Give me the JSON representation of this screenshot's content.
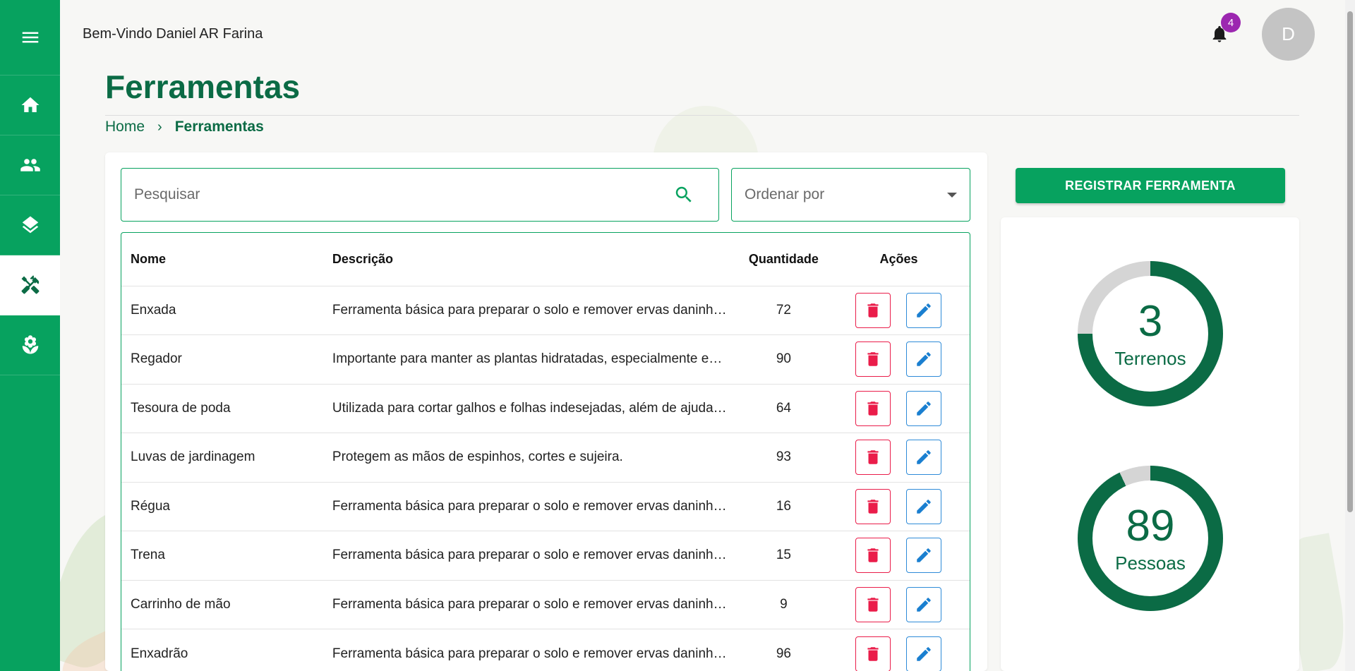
{
  "header": {
    "welcome_text": "Bem-Vindo Daniel AR Farina",
    "notification_count": "4",
    "avatar_initial": "D"
  },
  "page": {
    "title": "Ferramentas",
    "breadcrumb": [
      "Home",
      "Ferramentas"
    ]
  },
  "sidebar": {
    "items": [
      {
        "icon": "menu-icon"
      },
      {
        "icon": "home-icon"
      },
      {
        "icon": "people-icon"
      },
      {
        "icon": "layers-icon"
      },
      {
        "icon": "tools-icon",
        "active": true
      },
      {
        "icon": "plant-icon"
      }
    ]
  },
  "search": {
    "placeholder": "Pesquisar"
  },
  "sort": {
    "label": "Ordenar por"
  },
  "table": {
    "headers": [
      "Nome",
      "Descrição",
      "Quantidade",
      "Ações"
    ],
    "rows": [
      {
        "nome": "Enxada",
        "descricao": "Ferramenta básica para preparar o solo e remover ervas daninhas.",
        "quantidade": "72"
      },
      {
        "nome": "Regador",
        "descricao": "Importante para manter as plantas hidratadas, especialmente em ...",
        "quantidade": "90"
      },
      {
        "nome": "Tesoura de poda",
        "descricao": "Utilizada para cortar galhos e folhas indesejadas, além de ajudar ...",
        "quantidade": "64"
      },
      {
        "nome": "Luvas de jardinagem",
        "descricao": "Protegem as mãos de espinhos, cortes e sujeira.",
        "quantidade": "93"
      },
      {
        "nome": "Régua",
        "descricao": "Ferramenta básica para preparar o solo e remover ervas daninhas.",
        "quantidade": "16"
      },
      {
        "nome": "Trena",
        "descricao": "Ferramenta básica para preparar o solo e remover ervas daninhas.",
        "quantidade": "15"
      },
      {
        "nome": "Carrinho de mão",
        "descricao": "Ferramenta básica para preparar o solo e remover ervas daninhas.",
        "quantidade": "9"
      },
      {
        "nome": "Enxadrão",
        "descricao": "Ferramenta básica para preparar o solo e remover ervas daninhas.",
        "quantidade": "96"
      }
    ]
  },
  "register_button": {
    "label": "REGISTRAR FERRAMENTA"
  },
  "stats": [
    {
      "value": "3",
      "label": "Terrenos",
      "fill_fraction": 0.75
    },
    {
      "value": "89",
      "label": "Pessoas",
      "fill_fraction": 0.93
    }
  ],
  "colors": {
    "primary": "#07a25f",
    "primary_dark": "#0b6b45",
    "danger": "#ea1d4a",
    "edit": "#1a7fd0",
    "badge": "#9c27b0",
    "track": "#d5d5d5"
  }
}
